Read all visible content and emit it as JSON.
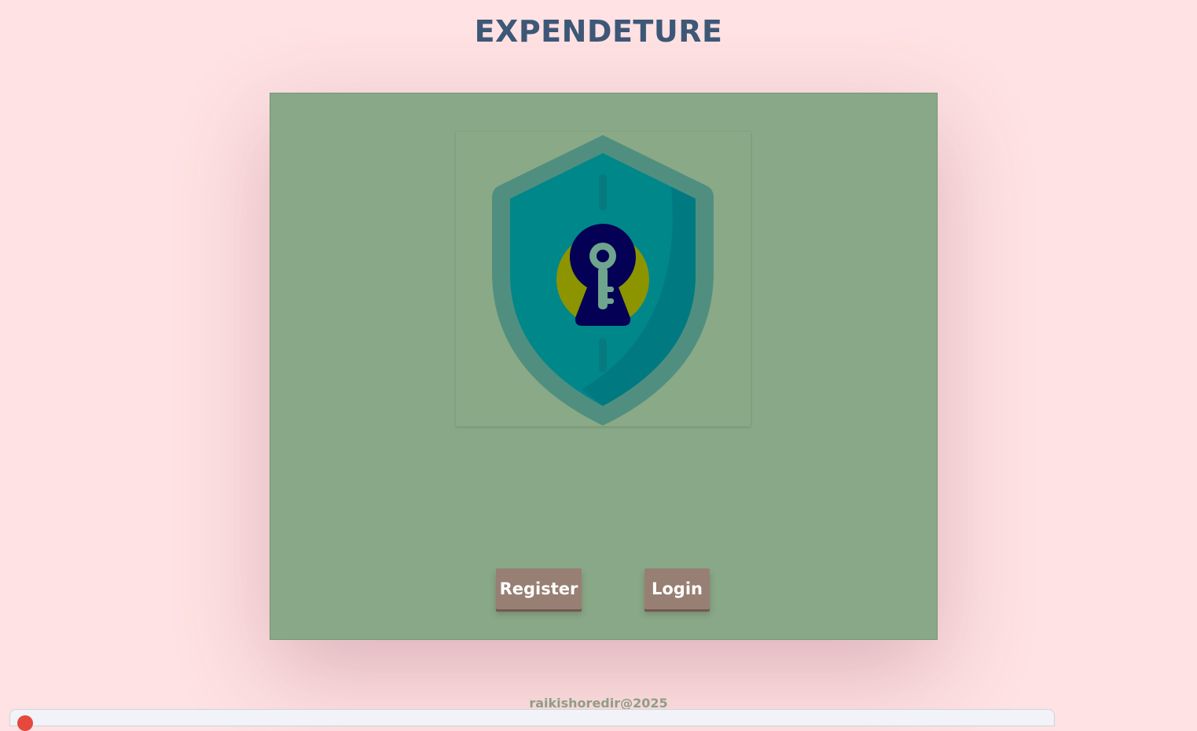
{
  "header": {
    "title": "EXPENDETURE"
  },
  "hero": {
    "logo_icon": "shield-keyhole-icon"
  },
  "actions": {
    "register_label": "Register",
    "login_label": "Login"
  },
  "footer": {
    "text": "raikishoredir@2025"
  },
  "colors": {
    "page_background": "#ffe2e3",
    "title": "#3e5878",
    "panel": "#89a887",
    "button": "#987f73",
    "button_text": "#ffffff",
    "footer_text": "#8e9e86"
  }
}
